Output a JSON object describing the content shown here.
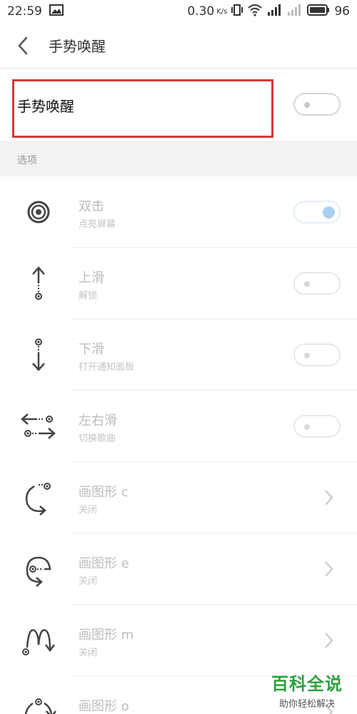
{
  "status": {
    "time": "22:59",
    "speed": "0.30",
    "speed_unit": "K/s",
    "battery": "96"
  },
  "appbar": {
    "title": "手势唤醒"
  },
  "master": {
    "label": "手势唤醒",
    "enabled": false
  },
  "section": {
    "label": "选项"
  },
  "gestures": [
    {
      "title": "双击",
      "subtitle": "点亮屏幕",
      "control": "switch",
      "on": true,
      "icon": "target-icon"
    },
    {
      "title": "上滑",
      "subtitle": "解锁",
      "control": "switch",
      "on": false,
      "icon": "swipe-up-icon"
    },
    {
      "title": "下滑",
      "subtitle": "打开通知面板",
      "control": "switch",
      "on": false,
      "icon": "swipe-down-icon"
    },
    {
      "title": "左右滑",
      "subtitle": "切换歌曲",
      "control": "switch",
      "on": false,
      "icon": "swipe-left-right-icon"
    },
    {
      "title": "画图形 c",
      "subtitle": "关闭",
      "control": "chevron",
      "icon": "draw-c-icon"
    },
    {
      "title": "画图形 e",
      "subtitle": "关闭",
      "control": "chevron",
      "icon": "draw-e-icon"
    },
    {
      "title": "画图形 m",
      "subtitle": "关闭",
      "control": "chevron",
      "icon": "draw-m-icon"
    },
    {
      "title": "画图形 o",
      "subtitle": "",
      "control": "chevron",
      "icon": "draw-o-icon"
    }
  ],
  "watermark": {
    "main": "百科全说",
    "sub": "助你轻松解决"
  },
  "colors": {
    "highlight": "#d23b3b",
    "switch_on": "#a9cff0",
    "watermark": "#2ea043"
  }
}
